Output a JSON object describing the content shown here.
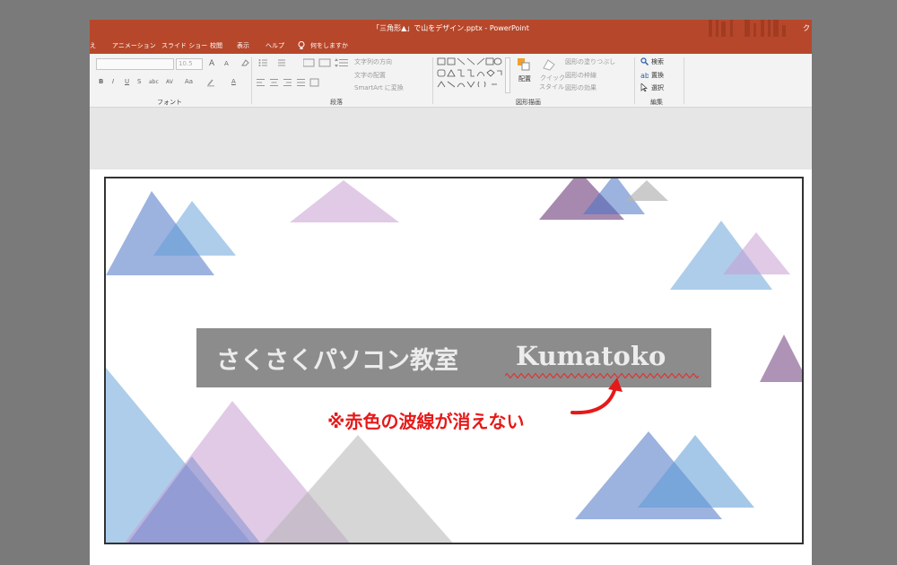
{
  "window": {
    "title": "「三角形▲」で山をデザイン.pptx  -  PowerPoint",
    "user_label": "ク"
  },
  "menu": {
    "items": [
      "え",
      "アニメーション",
      "スライド ショー",
      "校閲",
      "表示",
      "ヘルプ"
    ],
    "tell_me": "何をしますか"
  },
  "ribbon": {
    "font_group": {
      "label": "フォント",
      "font_name": "",
      "font_size": "10.5",
      "grow_label": "A",
      "shrink_label": "A",
      "bold": "B",
      "italic": "I",
      "underline": "U",
      "strike": "S",
      "shadow": "abc",
      "spacing": "AV",
      "case": "Aa",
      "font_color": "A"
    },
    "paragraph_group": {
      "label": "段落",
      "text_direction": "文字列の方向",
      "align_text": "文字の配置",
      "smartart": "SmartArt に変換"
    },
    "drawing_group": {
      "label": "図形描画",
      "arrange": "配置",
      "quick_style_1": "クイック",
      "quick_style_2": "スタイル",
      "shape_fill": "図形の塗りつぶし",
      "shape_outline": "図形の枠線",
      "shape_effects": "図形の効果"
    },
    "edit_group": {
      "label": "編集",
      "find": "検索",
      "replace": "置換",
      "select": "選択"
    }
  },
  "slide": {
    "title": "さくさくパソコン教室",
    "brand": "Kumatoko",
    "spellcheck_underline_color": "#d33"
  },
  "annotation": {
    "text": "※赤色の波線が消えない",
    "color": "#e61919"
  },
  "colors": {
    "ppt_accent": "#b7472a",
    "triangle_blue": "#4a72c4",
    "triangle_lightblue": "#5b9bd5",
    "triangle_purple": "#c79fd1",
    "triangle_darkpurple": "#6d3b7a",
    "triangle_gray": "#b5b5b5"
  }
}
